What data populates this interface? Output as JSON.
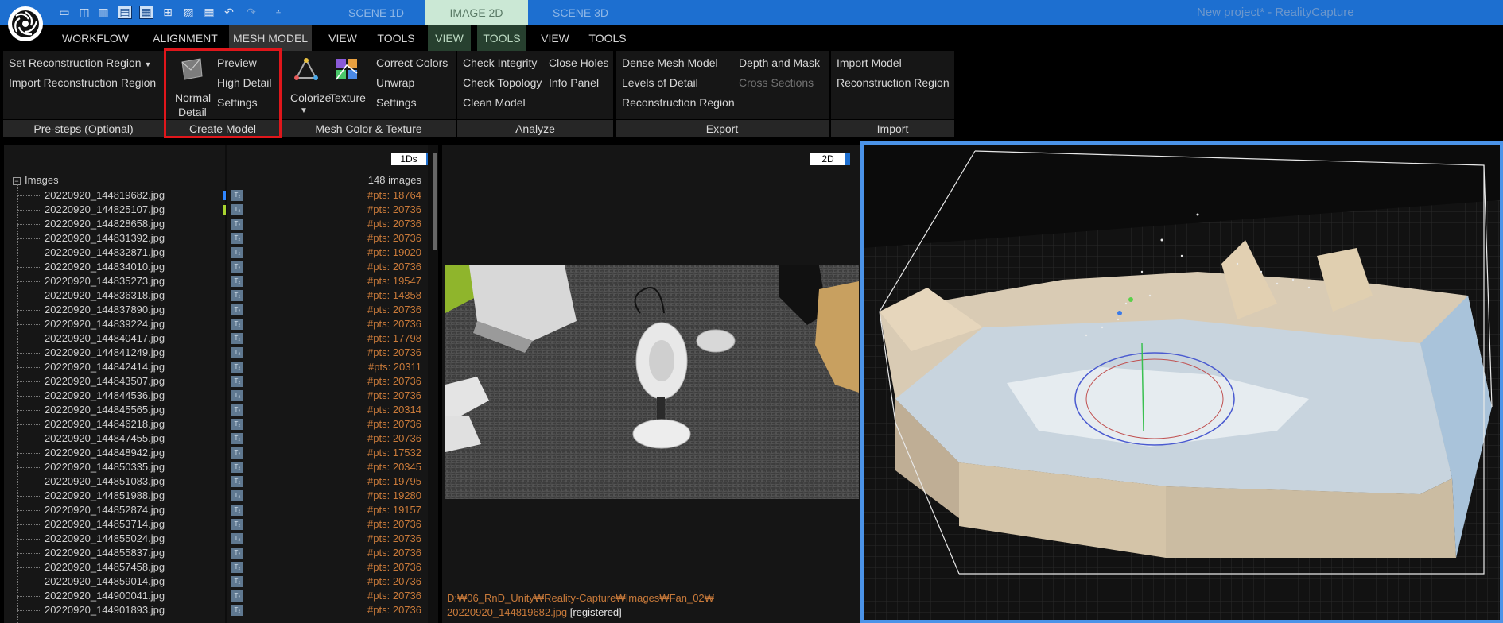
{
  "window": {
    "title": "New project* - RealityCapture"
  },
  "layout_tabs": [
    {
      "label": "SCENE 1D"
    },
    {
      "label": "IMAGE 2D"
    },
    {
      "label": "SCENE 3D"
    }
  ],
  "quick_toolbar": {
    "icons": [
      "layout-1-icon",
      "layout-2-icon",
      "layout-3-icon",
      "layout-4-icon",
      "layout-5-icon",
      "layout-6-icon",
      "layout-7-icon",
      "layout-8-icon",
      "undo-icon",
      "redo-icon",
      "customize-icon"
    ]
  },
  "menus": [
    {
      "label": "WORKFLOW"
    },
    {
      "label": "ALIGNMENT"
    },
    {
      "label": "MESH MODEL"
    },
    {
      "label": "VIEW"
    },
    {
      "label": "TOOLS"
    },
    {
      "label": "VIEW"
    },
    {
      "label": "TOOLS"
    },
    {
      "label": "VIEW"
    },
    {
      "label": "TOOLS"
    }
  ],
  "ribbon": {
    "presteps": {
      "items": [
        "Set Reconstruction Region",
        "Import Reconstruction Region"
      ],
      "title": "Pre-steps (Optional)"
    },
    "create_model": {
      "big_button": [
        "Normal",
        "Detail"
      ],
      "items": [
        "Preview",
        "High Detail",
        "Settings"
      ],
      "title": "Create Model"
    },
    "mesh_color": {
      "colorize": "Colorize",
      "texture": "Texture",
      "items": [
        "Correct Colors",
        "Unwrap",
        "Settings"
      ],
      "title": "Mesh Color & Texture"
    },
    "analyze": {
      "items": [
        "Check Integrity",
        "Check Topology",
        "Clean Model",
        "Close Holes",
        "Info Panel"
      ],
      "title": "Analyze"
    },
    "export": {
      "items": [
        "Dense Mesh Model",
        "Levels of Detail",
        "Reconstruction Region",
        "Depth and Mask",
        "Cross Sections"
      ],
      "title": "Export"
    },
    "import": {
      "items": [
        "Import Model",
        "Reconstruction Region"
      ],
      "title": "Import"
    }
  },
  "left_panel": {
    "badge": "1Ds",
    "root_label": "Images",
    "count": "148 images",
    "images": [
      {
        "name": "20220920_144819682.jpg",
        "pts": "#pts: 18764"
      },
      {
        "name": "20220920_144825107.jpg",
        "pts": "#pts: 20736"
      },
      {
        "name": "20220920_144828658.jpg",
        "pts": "#pts: 20736"
      },
      {
        "name": "20220920_144831392.jpg",
        "pts": "#pts: 20736"
      },
      {
        "name": "20220920_144832871.jpg",
        "pts": "#pts: 19020"
      },
      {
        "name": "20220920_144834010.jpg",
        "pts": "#pts: 20736"
      },
      {
        "name": "20220920_144835273.jpg",
        "pts": "#pts: 19547"
      },
      {
        "name": "20220920_144836318.jpg",
        "pts": "#pts: 14358"
      },
      {
        "name": "20220920_144837890.jpg",
        "pts": "#pts: 20736"
      },
      {
        "name": "20220920_144839224.jpg",
        "pts": "#pts: 20736"
      },
      {
        "name": "20220920_144840417.jpg",
        "pts": "#pts: 17798"
      },
      {
        "name": "20220920_144841249.jpg",
        "pts": "#pts: 20736"
      },
      {
        "name": "20220920_144842414.jpg",
        "pts": "#pts: 20311"
      },
      {
        "name": "20220920_144843507.jpg",
        "pts": "#pts: 20736"
      },
      {
        "name": "20220920_144844536.jpg",
        "pts": "#pts: 20736"
      },
      {
        "name": "20220920_144845565.jpg",
        "pts": "#pts: 20314"
      },
      {
        "name": "20220920_144846218.jpg",
        "pts": "#pts: 20736"
      },
      {
        "name": "20220920_144847455.jpg",
        "pts": "#pts: 20736"
      },
      {
        "name": "20220920_144848942.jpg",
        "pts": "#pts: 17532"
      },
      {
        "name": "20220920_144850335.jpg",
        "pts": "#pts: 20345"
      },
      {
        "name": "20220920_144851083.jpg",
        "pts": "#pts: 19795"
      },
      {
        "name": "20220920_144851988.jpg",
        "pts": "#pts: 19280"
      },
      {
        "name": "20220920_144852874.jpg",
        "pts": "#pts: 19157"
      },
      {
        "name": "20220920_144853714.jpg",
        "pts": "#pts: 20736"
      },
      {
        "name": "20220920_144855024.jpg",
        "pts": "#pts: 20736"
      },
      {
        "name": "20220920_144855837.jpg",
        "pts": "#pts: 20736"
      },
      {
        "name": "20220920_144857458.jpg",
        "pts": "#pts: 20736"
      },
      {
        "name": "20220920_144859014.jpg",
        "pts": "#pts: 20736"
      },
      {
        "name": "20220920_144900041.jpg",
        "pts": "#pts: 20736"
      },
      {
        "name": "20220920_144901893.jpg",
        "pts": "#pts: 20736"
      }
    ]
  },
  "mid_panel": {
    "badge": "2D",
    "path": "D:₩06_RnD_Unity₩Reality-Capture₩Images₩Fan_02₩",
    "file": "20220920_144819682.jpg",
    "status": "[registered]"
  },
  "colors": {
    "title_bar": "#1d6fd0",
    "active_tab": "#cbe8d5",
    "points_text": "#c97a3a",
    "selection_border": "#4b93e8",
    "highlight_box": "#e0161b"
  }
}
